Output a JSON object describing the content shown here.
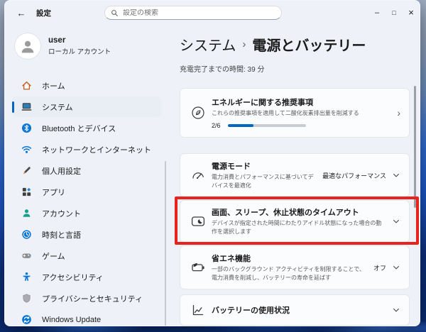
{
  "window": {
    "titlebar": {
      "back_icon": "←",
      "app_title": "設定",
      "search_placeholder": "設定の検索",
      "minimize_icon": "–",
      "maximize_icon": "□",
      "close_icon": "×"
    },
    "sidebar": {
      "user": {
        "name": "user",
        "account_type": "ローカル アカウント"
      },
      "items": [
        {
          "icon": "home-icon",
          "label": "ホーム",
          "selected": false
        },
        {
          "icon": "system-icon",
          "label": "システム",
          "selected": true
        },
        {
          "icon": "bluetooth-icon",
          "label": "Bluetooth とデバイス",
          "selected": false
        },
        {
          "icon": "network-icon",
          "label": "ネットワークとインターネット",
          "selected": false
        },
        {
          "icon": "personalization-icon",
          "label": "個人用設定",
          "selected": false
        },
        {
          "icon": "apps-icon",
          "label": "アプリ",
          "selected": false
        },
        {
          "icon": "accounts-icon",
          "label": "アカウント",
          "selected": false
        },
        {
          "icon": "time-language-icon",
          "label": "時刻と言語",
          "selected": false
        },
        {
          "icon": "gaming-icon",
          "label": "ゲーム",
          "selected": false
        },
        {
          "icon": "accessibility-icon",
          "label": "アクセシビリティ",
          "selected": false
        },
        {
          "icon": "privacy-icon",
          "label": "プライバシーとセキュリティ",
          "selected": false
        },
        {
          "icon": "windows-update-icon",
          "label": "Windows Update",
          "selected": false
        }
      ]
    },
    "content": {
      "breadcrumb": {
        "parent": "システム",
        "separator": "›",
        "current": "電源とバッテリー"
      },
      "status_line": "充電完了までの時間: 39 分",
      "cards": {
        "energy_recommendations": {
          "icon": "leaf-circle-icon",
          "title": "エネルギーに関する推奨事項",
          "subtitle": "これらの推奨事項を適用して二酸化炭素排出量を削減する",
          "progress_label": "2/6",
          "progress_value": 2,
          "progress_max": 6,
          "chevron": "›"
        },
        "power_mode": {
          "icon": "gauge-icon",
          "title": "電源モード",
          "subtitle": "電力消費とパフォーマンスに基づいてデバイスを最適化",
          "value": "最適なパフォーマンス"
        },
        "screen_sleep_timeouts": {
          "icon": "display-moon-icon",
          "title": "画面、スリープ、休止状態のタイムアウト",
          "subtitle": "デバイスが指定された時間にわたりアイドル状態になった場合の動作を選択します",
          "highlighted": true
        },
        "energy_saver": {
          "icon": "battery-leaf-icon",
          "title": "省エネ機能",
          "subtitle": "一部のバックグラウンド アクティビティを制限することで、電力消費を削減し、バッテリーの寿命を延ばす",
          "value": "オフ"
        },
        "battery_usage": {
          "icon": "line-chart-icon",
          "title": "バッテリーの使用状況"
        }
      }
    }
  },
  "colors": {
    "accent": "#0067c0",
    "highlight_red": "#e8231d",
    "progress_track": "#c9cdd2"
  }
}
